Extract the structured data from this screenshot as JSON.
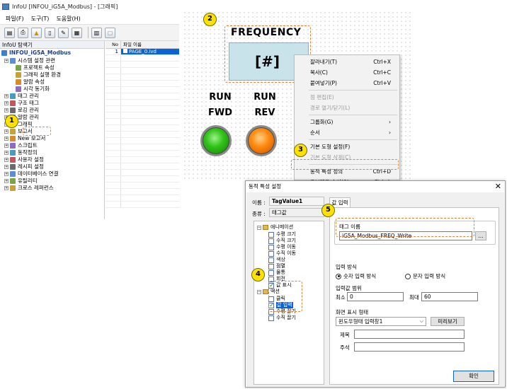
{
  "window": {
    "title": "InfoU [INFOU_iG5A_Modbus] - [그래픽]"
  },
  "menu": [
    "파일(F)",
    "도구(T)",
    "도움말(H)"
  ],
  "toolbar_icons": [
    "save-icon",
    "print-icon",
    "warning-icon",
    "document-icon",
    "settings-icon",
    "monitor-icon",
    "chart-icon",
    "help-icon"
  ],
  "explorer": {
    "header": "InfoU 탐색기",
    "root": "INFOU_iG5A_Modbus",
    "items": [
      {
        "label": "시스템 설정 관련",
        "level": 1,
        "icon": "system-icon"
      },
      {
        "label": "프로젝트 속성",
        "level": 2,
        "icon": "project-icon"
      },
      {
        "label": "그래픽 실행 환경",
        "level": 2,
        "icon": "graphic-env-icon"
      },
      {
        "label": "알람 속성",
        "level": 2,
        "icon": "alarm-prop-icon"
      },
      {
        "label": "시각 동기화",
        "level": 2,
        "icon": "clock-icon"
      },
      {
        "label": "태그 관리",
        "level": 1,
        "icon": "tag-icon"
      },
      {
        "label": "구조 태그",
        "level": 1,
        "icon": "struct-tag-icon"
      },
      {
        "label": "로깅 관리",
        "level": 1,
        "icon": "logging-icon"
      },
      {
        "label": "알람 관리",
        "level": 1,
        "icon": "alarm-icon"
      },
      {
        "label": "그래픽",
        "level": 1,
        "icon": "graphic-icon"
      },
      {
        "label": "보고서",
        "level": 1,
        "icon": "report-icon"
      },
      {
        "label": "New 보고서",
        "level": 1,
        "icon": "new-report-icon"
      },
      {
        "label": "스크립트",
        "level": 1,
        "icon": "script-icon"
      },
      {
        "label": "동작정의",
        "level": 1,
        "icon": "action-icon"
      },
      {
        "label": "사용자 설정",
        "level": 1,
        "icon": "user-icon"
      },
      {
        "label": "레시피 설정",
        "level": 1,
        "icon": "recipe-icon"
      },
      {
        "label": "데이터베이스 연결",
        "level": 1,
        "icon": "database-icon"
      },
      {
        "label": "유틸리티",
        "level": 1,
        "icon": "utility-icon"
      },
      {
        "label": "크로스 레퍼런스",
        "level": 1,
        "icon": "cross-ref-icon"
      }
    ]
  },
  "file_grid": {
    "col_no": "No",
    "col_name": "파일 이름",
    "rows": [
      {
        "no": "1",
        "name": "PAGE_0.ivd"
      }
    ]
  },
  "canvas": {
    "freq_label": "FREQUENCY",
    "freq_value": "[#]",
    "run_fwd": [
      "RUN",
      "FWD"
    ],
    "run_rev": [
      "RUN",
      "REV"
    ]
  },
  "context_menu": [
    {
      "label": "잘라내기(T)",
      "shortcut": "Ctrl+X",
      "disabled": false
    },
    {
      "label": "복사(C)",
      "shortcut": "Ctrl+C",
      "disabled": false
    },
    {
      "label": "붙여넣기(P)",
      "shortcut": "Ctrl+V",
      "disabled": false
    },
    {
      "label": "점 편집(E)",
      "shortcut": "",
      "disabled": true
    },
    {
      "label": "경로 열기/닫기(L)",
      "shortcut": "",
      "disabled": true
    },
    {
      "label": "그룹화(G)",
      "shortcut": "›",
      "disabled": false
    },
    {
      "label": "순서",
      "shortcut": "›",
      "disabled": false
    },
    {
      "label": "기본 도형 설정(F)",
      "shortcut": "",
      "disabled": false
    },
    {
      "label": "기본 도형 삭제(C)",
      "shortcut": "",
      "disabled": true
    },
    {
      "label": "동적 특성 정의",
      "shortcut": "Ctrl+D",
      "disabled": false
    },
    {
      "label": "오브젝트 속성(A)",
      "shortcut": "Ctrl+L",
      "disabled": false
    }
  ],
  "dialog": {
    "title": "동적 특성 설정",
    "name_label": "이름 :",
    "name_value": "TagValue1",
    "type_label": "종류 :",
    "type_value": "태그값",
    "tab_label": "값 입력",
    "tree_root": "애니메이션",
    "tree_anim": [
      "수평 크기",
      "수직 크기",
      "수평 이동",
      "수직 이동",
      "색상",
      "점멸",
      "물통",
      "회전",
      "값 표시"
    ],
    "tree_action_root": "액션",
    "tree_action": [
      "클릭",
      "값 입력",
      "수평 끌기",
      "수직 끌기"
    ],
    "tag_group": "태그 이름",
    "tag_value": "iG5A_Modbus_FREQ_Write",
    "browse_btn": "...",
    "input_mode_group": "입력 방식",
    "radio_numeric": "숫자 입력 방식",
    "radio_text": "문자 입력 방식",
    "range_group": "입력값 범위",
    "min_label": "최소",
    "min_value": "0",
    "max_label": "최대",
    "max_value": "60",
    "display_group": "화면 표시 형태",
    "display_value": "윈도우형태 입력창1",
    "preview_btn": "미리보기",
    "title_label": "제목",
    "comment_label": "주석",
    "ok_btn": "확인"
  },
  "badges": [
    "1",
    "2",
    "3",
    "4",
    "5"
  ],
  "colors": {
    "accent": "#0a64d6",
    "callout": "#e0823a",
    "badge": "#ffe100",
    "display_box": "#c9e3ea"
  }
}
